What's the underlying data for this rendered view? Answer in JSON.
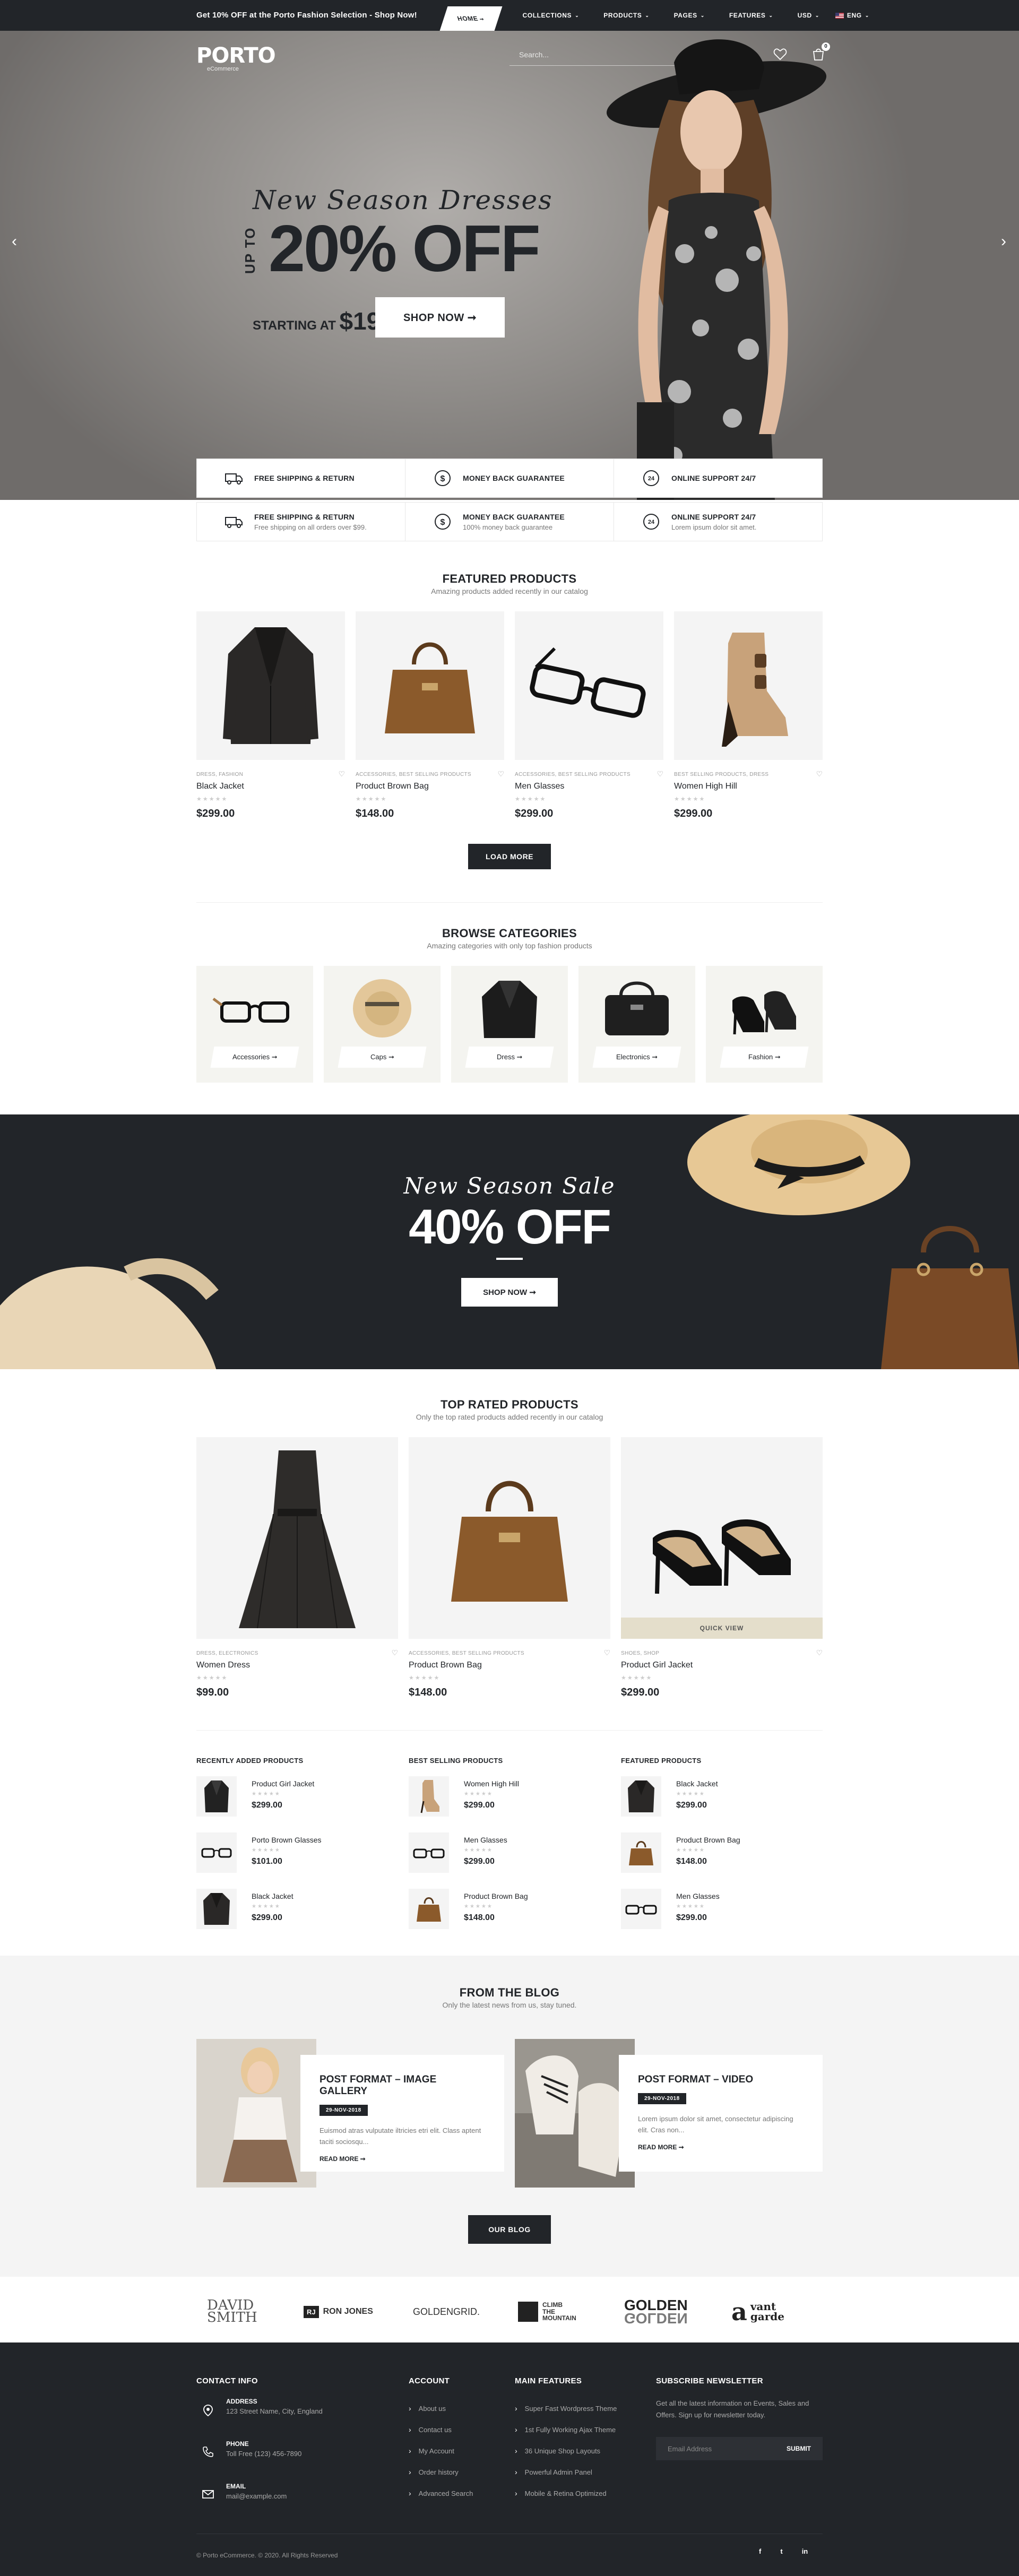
{
  "topbar": {
    "promo_prefix": "Get 10% OFF at the Porto Fashion Selection - ",
    "promo_link": "Shop Now!",
    "nav": [
      {
        "label": "HOME",
        "suffix": "➞"
      },
      {
        "label": "COLLECTIONS",
        "suffix": "⌄"
      },
      {
        "label": "PRODUCTS",
        "suffix": "⌄"
      },
      {
        "label": "PAGES",
        "suffix": "⌄"
      },
      {
        "label": "FEATURES",
        "suffix": "⌄"
      },
      {
        "label": "USD",
        "suffix": "⌄"
      },
      {
        "label": "ENG",
        "suffix": "⌄"
      }
    ]
  },
  "header": {
    "logo": "PORTO",
    "logo_sub": "eCommerce",
    "search_placeholder": "Search...",
    "cart_count": "0",
    "icons": [
      "search-icon",
      "user-icon",
      "heart-icon",
      "cart-icon"
    ]
  },
  "hero": {
    "subtitle": "New Season Dresses",
    "upto": "UP TO",
    "headline": "20% OFF",
    "starting_label": "STARTING AT",
    "price_main": "$19",
    "price_cents": "99",
    "button": "SHOP NOW ➞"
  },
  "features": [
    {
      "title": "FREE SHIPPING & RETURN",
      "sub": "Free shipping on all orders over $99.",
      "icon": "truck-icon"
    },
    {
      "title": "MONEY BACK GUARANTEE",
      "sub": "100% money back guarantee",
      "icon": "dollar-icon"
    },
    {
      "title": "ONLINE SUPPORT 24/7",
      "sub": "Lorem ipsum dolor sit amet.",
      "icon": "support-24-icon"
    }
  ],
  "featured": {
    "title": "FEATURED PRODUCTS",
    "subtitle": "Amazing products added recently in our catalog",
    "products": [
      {
        "cat": "DRESS, FASHION",
        "name": "Black Jacket",
        "price": "$299.00",
        "stars": "★★★★★"
      },
      {
        "cat": "ACCESSORIES, BEST SELLING PRODUCTS",
        "name": "Product Brown Bag",
        "price": "$148.00",
        "stars": "★★★★★"
      },
      {
        "cat": "ACCESSORIES, BEST SELLING PRODUCTS",
        "name": "Men Glasses",
        "price": "$299.00",
        "stars": "★★★★★"
      },
      {
        "cat": "BEST SELLING PRODUCTS, DRESS",
        "name": "Women High Hill",
        "price": "$299.00",
        "stars": "★★★★★"
      }
    ],
    "load_more": "LOAD MORE"
  },
  "categories": {
    "title": "BROWSE CATEGORIES",
    "subtitle": "Amazing categories with only top fashion products",
    "items": [
      {
        "label": "Accessories ➞"
      },
      {
        "label": "Caps ➞"
      },
      {
        "label": "Dress ➞"
      },
      {
        "label": "Electronics ➞"
      },
      {
        "label": "Fashion ➞"
      }
    ]
  },
  "sale": {
    "subtitle": "New Season Sale",
    "headline": "40% OFF",
    "button": "SHOP NOW ➞"
  },
  "top_rated": {
    "title": "TOP RATED PRODUCTS",
    "subtitle": "Only the top rated products added recently in our catalog",
    "quick_view": "QUICK VIEW",
    "products": [
      {
        "cat": "DRESS, ELECTRONICS",
        "name": "Women Dress",
        "price": "$99.00",
        "stars": "★★★★★"
      },
      {
        "cat": "ACCESSORIES, BEST SELLING PRODUCTS",
        "name": "Product Brown Bag",
        "price": "$148.00",
        "stars": "★★★★★"
      },
      {
        "cat": "SHOES, SHOP",
        "name": "Product Girl Jacket",
        "price": "$299.00",
        "stars": "★★★★★"
      }
    ]
  },
  "mini_lists": [
    {
      "title": "RECENTLY ADDED PRODUCTS",
      "items": [
        {
          "name": "Product Girl Jacket",
          "price": "$299.00"
        },
        {
          "name": "Porto Brown Glasses",
          "price": "$101.00"
        },
        {
          "name": "Black Jacket",
          "price": "$299.00"
        }
      ]
    },
    {
      "title": "BEST SELLING PRODUCTS",
      "items": [
        {
          "name": "Women High Hill",
          "price": "$299.00"
        },
        {
          "name": "Men Glasses",
          "price": "$299.00"
        },
        {
          "name": "Product Brown Bag",
          "price": "$148.00"
        }
      ]
    },
    {
      "title": "FEATURED PRODUCTS",
      "items": [
        {
          "name": "Black Jacket",
          "price": "$299.00"
        },
        {
          "name": "Product Brown Bag",
          "price": "$148.00"
        },
        {
          "name": "Men Glasses",
          "price": "$299.00"
        }
      ]
    }
  ],
  "mini_stars": "★★★★★",
  "blog": {
    "title": "FROM THE BLOG",
    "subtitle": "Only the latest news from us, stay tuned.",
    "posts": [
      {
        "title": "POST FORMAT – IMAGE GALLERY",
        "date": "29-NOV-2018",
        "excerpt": "Euismod atras vulputate iltricies etri elit. Class aptent taciti sociosqu...",
        "read_more": "READ MORE ➞"
      },
      {
        "title": "POST FORMAT – VIDEO",
        "date": "29-NOV-2018",
        "excerpt": "Lorem ipsum dolor sit amet, consectetur adipiscing elit. Cras non...",
        "read_more": "READ MORE ➞"
      }
    ],
    "button": "OUR BLOG"
  },
  "brands": [
    {
      "line1": "DAVID",
      "line2": "SMITH"
    },
    {
      "badge": "RJ",
      "line1": "RON JONES"
    },
    {
      "line1": "GOLDENGRID."
    },
    {
      "line1": "CLIMB",
      "line2": "THE",
      "line3": "MOUNTAIN"
    },
    {
      "line1": "GOLDEN",
      "line2": "GOLDEN"
    },
    {
      "line1": "vant",
      "line2": "garde"
    }
  ],
  "footer": {
    "contact_title": "CONTACT INFO",
    "contact": [
      {
        "label": "ADDRESS",
        "value": "123 Street Name, City, England",
        "icon": "map-pin-icon"
      },
      {
        "label": "PHONE",
        "value": "Toll Free (123) 456-7890",
        "icon": "phone-icon"
      },
      {
        "label": "EMAIL",
        "value": "mail@example.com",
        "icon": "mail-icon"
      }
    ],
    "account_title": "ACCOUNT",
    "account_links": [
      "About us",
      "Contact us",
      "My Account",
      "Order history",
      "Advanced Search"
    ],
    "features_title": "MAIN FEATURES",
    "features_links": [
      "Super Fast Wordpress Theme",
      "1st Fully Working Ajax Theme",
      "36 Unique Shop Layouts",
      "Powerful Admin Panel",
      "Mobile & Retina Optimized"
    ],
    "newsletter_title": "SUBSCRIBE NEWSLETTER",
    "newsletter_text": "Get all the latest information on Events, Sales and Offers. Sign up for newsletter today.",
    "newsletter_placeholder": "Email Address",
    "newsletter_button": "SUBMIT",
    "copyright": "© Porto eCommerce. © 2020. All Rights Reserved",
    "socials": [
      "f",
      "t",
      "in"
    ]
  }
}
